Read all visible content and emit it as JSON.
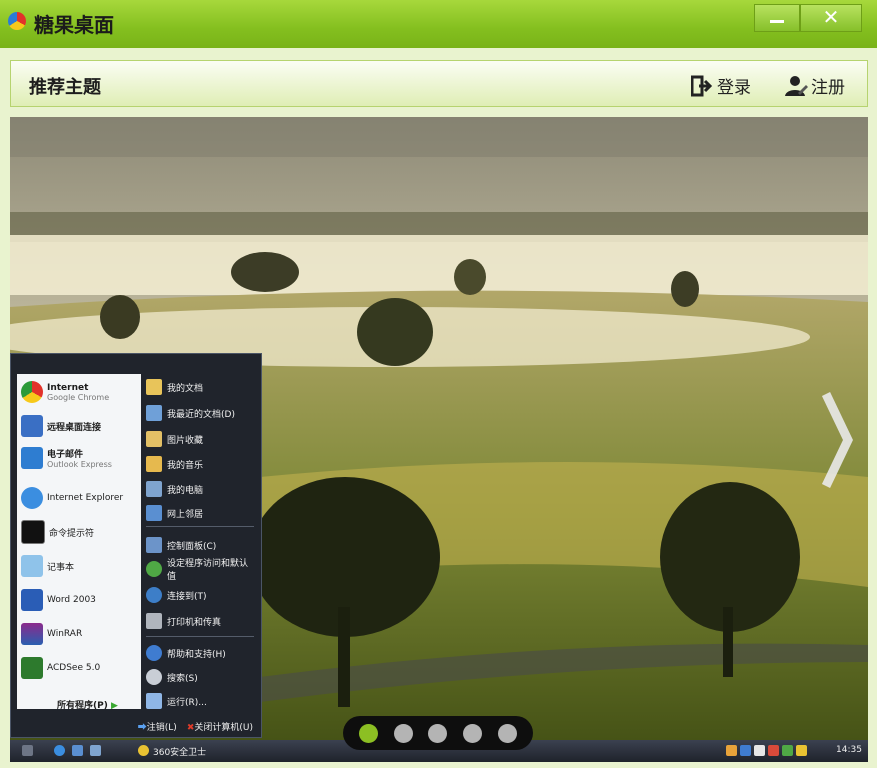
{
  "window": {
    "title": "糖果桌面",
    "minimize_label": "",
    "close_label": "✕"
  },
  "header": {
    "title": "推荐主题",
    "login_label": "登录",
    "register_label": "注册"
  },
  "carousel": {
    "pages": 5,
    "active_index": 0
  },
  "start_menu": {
    "left_items": [
      {
        "label": "Internet",
        "sub": "Google Chrome",
        "icon": "chrome-icon"
      },
      {
        "label": "远程桌面连接",
        "sub": "",
        "icon": "remote-desktop-icon"
      },
      {
        "label": "电子邮件",
        "sub": "Outlook Express",
        "icon": "mail-icon"
      },
      {
        "label": "Internet Explorer",
        "sub": "",
        "icon": "ie-icon"
      },
      {
        "label": "命令提示符",
        "sub": "",
        "icon": "cmd-icon"
      },
      {
        "label": "记事本",
        "sub": "",
        "icon": "notepad-icon"
      },
      {
        "label": "Word 2003",
        "sub": "",
        "icon": "word-icon"
      },
      {
        "label": "WinRAR",
        "sub": "",
        "icon": "winrar-icon"
      },
      {
        "label": "ACDSee 5.0",
        "sub": "",
        "icon": "acdsee-icon"
      }
    ],
    "all_programs": "所有程序(P)",
    "right_items": [
      {
        "label": "我的文档",
        "icon": "folder-icon"
      },
      {
        "label": "我最近的文档(D)",
        "icon": "recent-docs-icon"
      },
      {
        "label": "图片收藏",
        "icon": "pictures-icon"
      },
      {
        "label": "我的音乐",
        "icon": "music-icon"
      },
      {
        "label": "我的电脑",
        "icon": "computer-icon"
      },
      {
        "label": "网上邻居",
        "icon": "network-icon"
      },
      {
        "label": "控制面板(C)",
        "icon": "control-panel-icon"
      },
      {
        "label": "设定程序访问和默认值",
        "icon": "defaults-icon"
      },
      {
        "label": "连接到(T)",
        "icon": "connect-icon"
      },
      {
        "label": "打印机和传真",
        "icon": "printer-icon"
      },
      {
        "label": "帮助和支持(H)",
        "icon": "help-icon"
      },
      {
        "label": "搜索(S)",
        "icon": "search-icon"
      },
      {
        "label": "运行(R)...",
        "icon": "run-icon"
      }
    ],
    "logoff_label": "注销(L)",
    "shutdown_label": "关闭计算机(U)"
  },
  "taskbar": {
    "task_label": "360安全卫士",
    "clock": "14:35"
  },
  "colors": {
    "accent": "#8cbf23",
    "title_green": "#84bf1f"
  }
}
